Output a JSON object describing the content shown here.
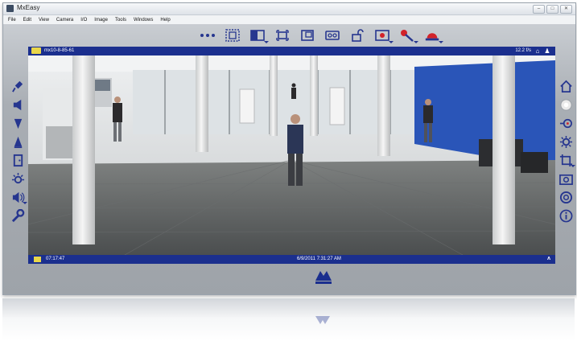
{
  "window": {
    "title": "MxEasy",
    "controls": [
      "minimize",
      "maximize",
      "close"
    ]
  },
  "menu": [
    "File",
    "Edit",
    "View",
    "Camera",
    "I/O",
    "Image",
    "Tools",
    "Windows",
    "Help"
  ],
  "toolbar_icons": [
    "more-icon",
    "camera-grid-icon",
    "layout-icon",
    "fullscreen-icon",
    "image-compare-icon",
    "recording-icon",
    "lock-icon",
    "record-icon",
    "tools-icon",
    "alarm-icon"
  ],
  "viewer": {
    "camera_name": "mx10-8-85-61",
    "fps": "12.2 f/s",
    "time": "07:17:47",
    "datetime": "6/9/2011 7:31:27 AM"
  },
  "left_icons": [
    "microphone-icon",
    "speaker-icon",
    "arrow-down-icon",
    "arrow-up-icon",
    "door-icon",
    "light-icon",
    "alarm-sound-icon",
    "wrench-icon"
  ],
  "right_icons": [
    "home-icon",
    "ring-icon",
    "target-icon",
    "settings-icon",
    "crop-icon",
    "snapshot-icon",
    "lifebuoy-icon",
    "info-icon"
  ],
  "colors": {
    "accent": "#1b2f8e",
    "icon": "#26368f"
  }
}
